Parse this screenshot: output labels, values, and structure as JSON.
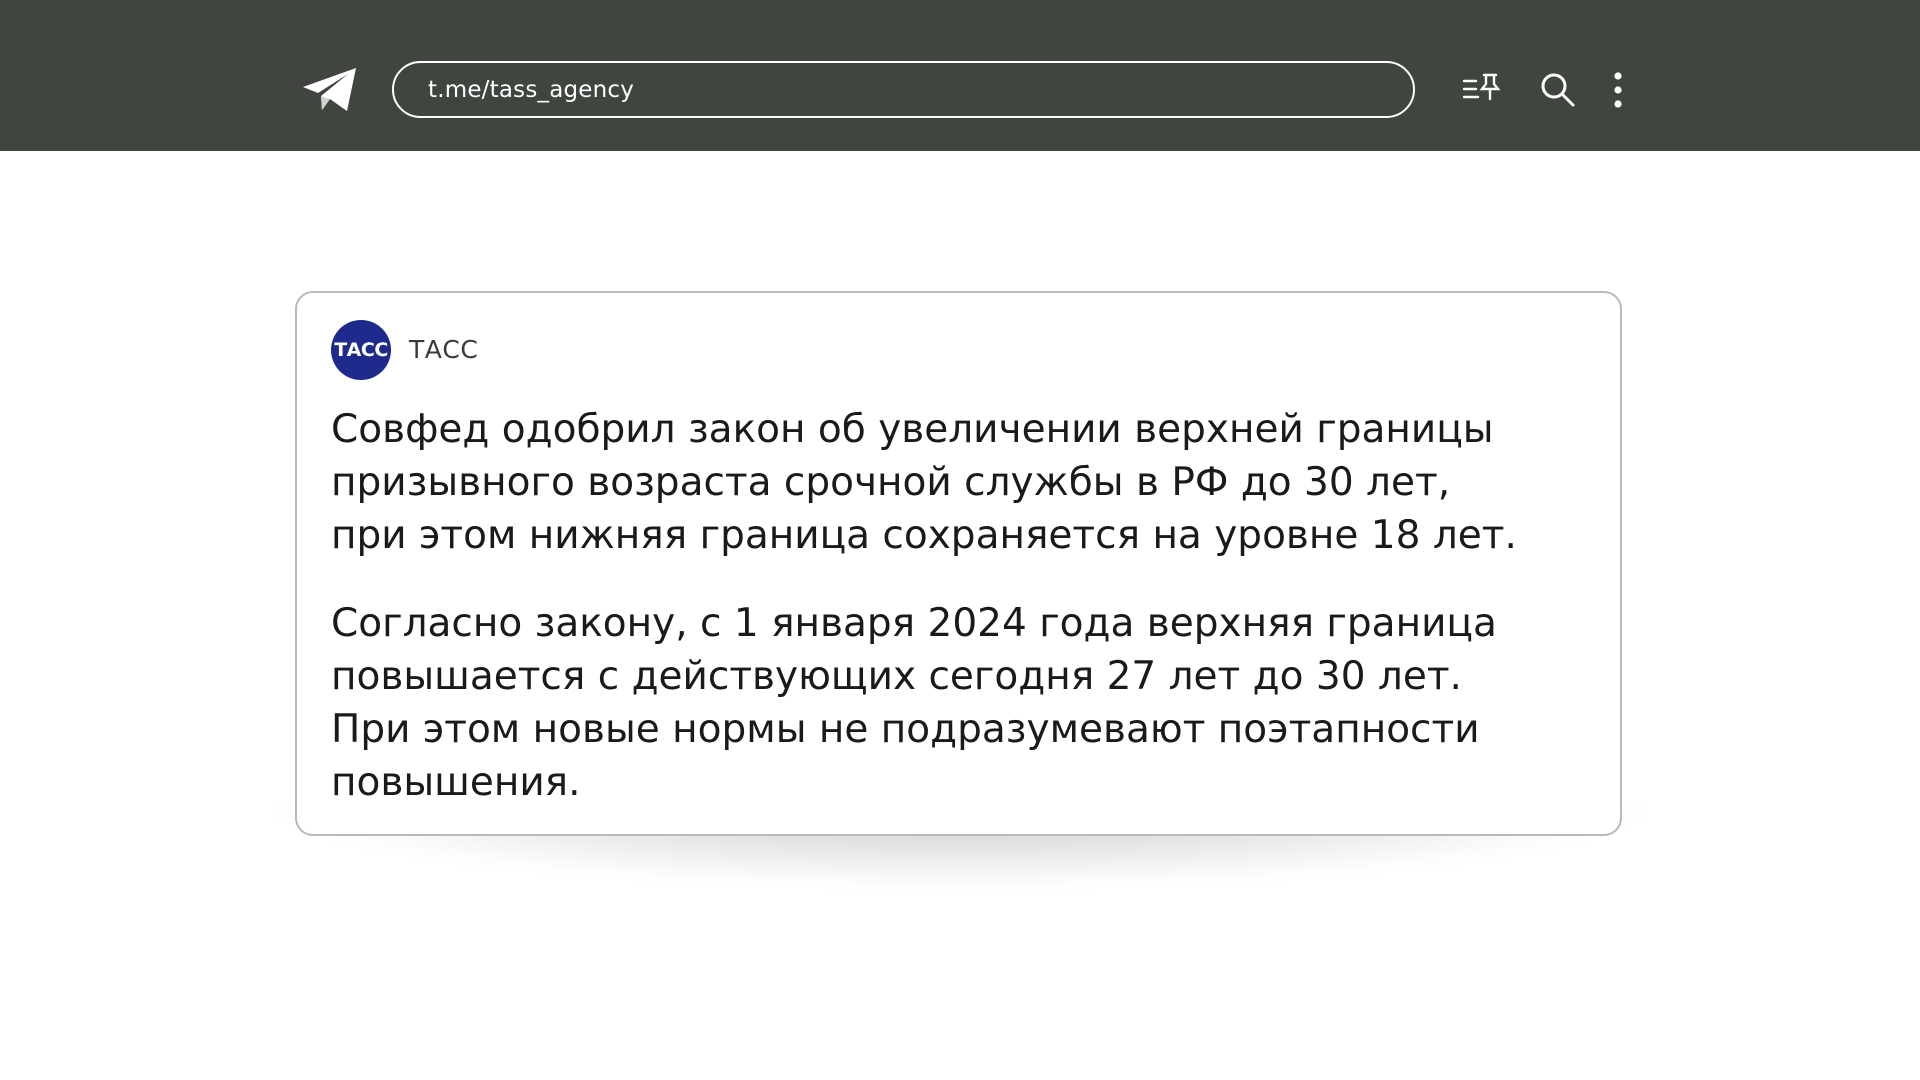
{
  "header": {
    "url": "t.me/tass_agency",
    "background_color": "#404540",
    "icons": [
      "telegram-logo-icon",
      "pinned-list-icon",
      "search-icon",
      "more-vertical-icon"
    ]
  },
  "post": {
    "channel_avatar_text": "ТАСС",
    "channel_name": "ТАСС",
    "avatar_color": "#1e2a8c",
    "paragraphs": [
      "Совфед одобрил закон об увеличении верхней границы\nпризывного возраста срочной службы в РФ до 30 лет,\nпри этом нижняя граница сохраняется на уровне 18 лет.",
      "Согласно закону, с 1 января 2024 года верхняя граница\nповышается с действующих сегодня 27 лет до 30 лет.\nПри этом новые нормы не подразумевают поэтапности\nповышения."
    ]
  }
}
